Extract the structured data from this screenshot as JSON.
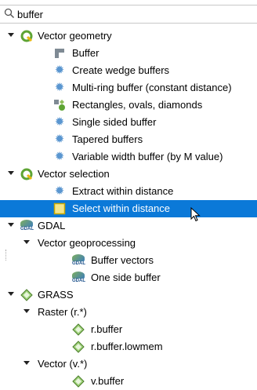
{
  "search": {
    "value": "buffer"
  },
  "tree": {
    "vector_geometry": {
      "label": "Vector geometry",
      "items": [
        "Buffer",
        "Create wedge buffers",
        "Multi-ring buffer (constant distance)",
        "Rectangles, ovals, diamonds",
        "Single sided buffer",
        "Tapered buffers",
        "Variable width buffer (by M value)"
      ]
    },
    "vector_selection": {
      "label": "Vector selection",
      "items": [
        "Extract within distance",
        "Select within distance"
      ]
    },
    "gdal": {
      "label": "GDAL",
      "vector_geoprocessing": {
        "label": "Vector geoprocessing",
        "items": [
          "Buffer vectors",
          "One side buffer"
        ]
      }
    },
    "grass": {
      "label": "GRASS",
      "raster": {
        "label": "Raster (r.*)",
        "items": [
          "r.buffer",
          "r.buffer.lowmem"
        ]
      },
      "vector": {
        "label": "Vector (v.*)",
        "items": [
          "v.buffer"
        ]
      }
    }
  },
  "colors": {
    "selection": "#0b79d8",
    "qgis_green": "#5ea434",
    "gear_blue": "#5a96d0"
  }
}
